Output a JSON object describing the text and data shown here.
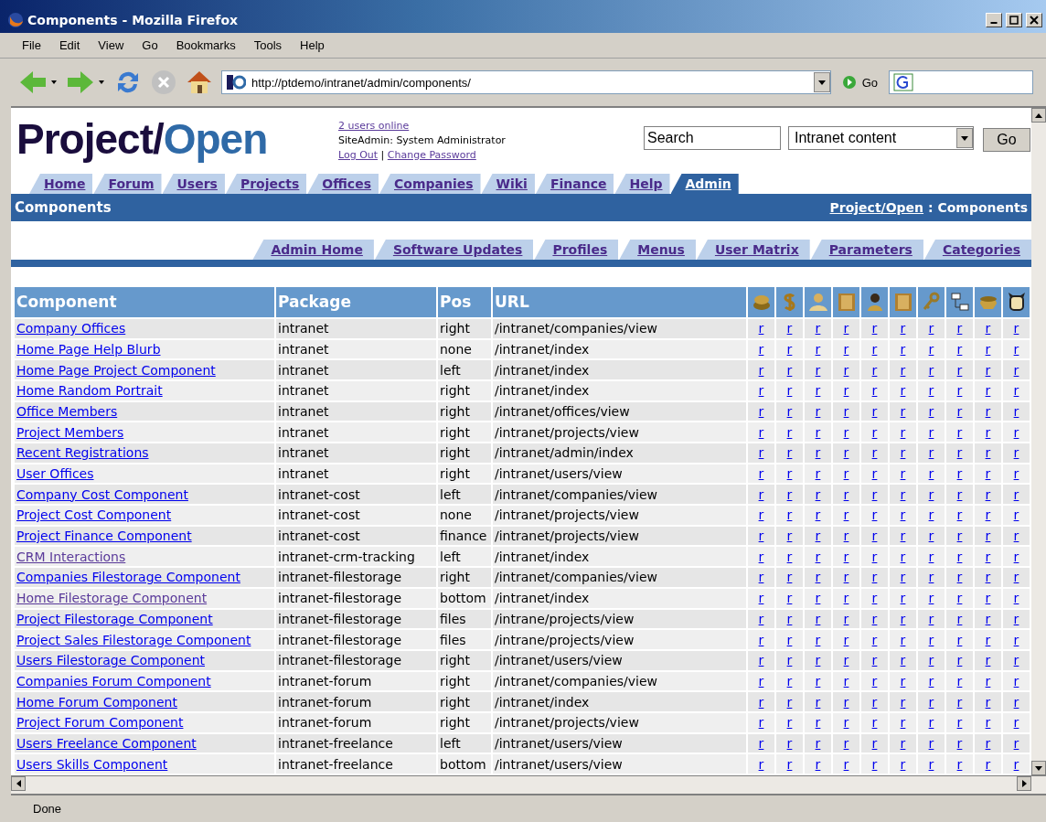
{
  "window": {
    "title": "Components - Mozilla Firefox"
  },
  "menu": [
    "File",
    "Edit",
    "View",
    "Go",
    "Bookmarks",
    "Tools",
    "Help"
  ],
  "toolbar": {
    "url": "http://ptdemo/intranet/admin/components/",
    "go": "Go"
  },
  "header": {
    "logo_dark": "Project/",
    "logo_light": "Open",
    "users_online": "2 users online",
    "user": "SiteAdmin: System Administrator",
    "logout": "Log Out",
    "separator": "|",
    "change_password": "Change Password",
    "search": {
      "value": "Search"
    },
    "scope": "Intranet content",
    "go": "Go"
  },
  "tabs": [
    {
      "label": "Home",
      "selected": false
    },
    {
      "label": "Forum",
      "selected": false
    },
    {
      "label": "Users",
      "selected": false
    },
    {
      "label": "Projects",
      "selected": false
    },
    {
      "label": "Offices",
      "selected": false
    },
    {
      "label": "Companies",
      "selected": false
    },
    {
      "label": "Wiki",
      "selected": false
    },
    {
      "label": "Finance",
      "selected": false
    },
    {
      "label": "Help",
      "selected": false
    },
    {
      "label": "Admin",
      "selected": true
    }
  ],
  "section": {
    "title": "Components",
    "breadcrumb_link": "Project/Open",
    "breadcrumb_rest": " : Components"
  },
  "subtabs": [
    "Admin Home",
    "Software Updates",
    "Profiles",
    "Menus",
    "User Matrix",
    "Parameters",
    "Categories"
  ],
  "table": {
    "columns": [
      "Component",
      "Package",
      "Pos",
      "URL"
    ],
    "rows": [
      {
        "component": "Company Offices",
        "visited": false,
        "package": "intranet",
        "pos": "right",
        "url": "/intranet/companies/view",
        "perms": [
          "r",
          "r",
          "r",
          "r",
          "r",
          "r",
          "r",
          "r",
          "r",
          "r"
        ]
      },
      {
        "component": "Home Page Help Blurb",
        "visited": false,
        "package": "intranet",
        "pos": "none",
        "url": "/intranet/index",
        "perms": [
          "r",
          "r",
          "r",
          "r",
          "r",
          "r",
          "r",
          "r",
          "r",
          "r"
        ]
      },
      {
        "component": "Home Page Project Component",
        "visited": false,
        "package": "intranet",
        "pos": "left",
        "url": "/intranet/index",
        "perms": [
          "r",
          "r",
          "r",
          "r",
          "r",
          "r",
          "r",
          "r",
          "r",
          "r"
        ]
      },
      {
        "component": "Home Random Portrait",
        "visited": false,
        "package": "intranet",
        "pos": "right",
        "url": "/intranet/index",
        "perms": [
          "r",
          "r",
          "r",
          "r",
          "r",
          "r",
          "r",
          "r",
          "r",
          "r"
        ]
      },
      {
        "component": "Office Members",
        "visited": false,
        "package": "intranet",
        "pos": "right",
        "url": "/intranet/offices/view",
        "perms": [
          "r",
          "r",
          "r",
          "r",
          "r",
          "r",
          "r",
          "r",
          "r",
          "r"
        ]
      },
      {
        "component": "Project Members",
        "visited": false,
        "package": "intranet",
        "pos": "right",
        "url": "/intranet/projects/view",
        "perms": [
          "r",
          "r",
          "r",
          "r",
          "r",
          "r",
          "r",
          "r",
          "r",
          "r"
        ]
      },
      {
        "component": "Recent Registrations",
        "visited": false,
        "package": "intranet",
        "pos": "right",
        "url": "/intranet/admin/index",
        "perms": [
          "r",
          "r",
          "r",
          "r",
          "r",
          "r",
          "r",
          "r",
          "r",
          "r"
        ]
      },
      {
        "component": "User Offices",
        "visited": false,
        "package": "intranet",
        "pos": "right",
        "url": "/intranet/users/view",
        "perms": [
          "r",
          "r",
          "r",
          "r",
          "r",
          "r",
          "r",
          "r",
          "r",
          "r"
        ]
      },
      {
        "component": "Company Cost Component",
        "visited": false,
        "package": "intranet-cost",
        "pos": "left",
        "url": "/intranet/companies/view",
        "perms": [
          "r",
          "r",
          "r",
          "r",
          "r",
          "r",
          "r",
          "r",
          "r",
          "r"
        ]
      },
      {
        "component": "Project Cost Component",
        "visited": false,
        "package": "intranet-cost",
        "pos": "none",
        "url": "/intranet/projects/view",
        "perms": [
          "r",
          "r",
          "r",
          "r",
          "r",
          "r",
          "r",
          "r",
          "r",
          "r"
        ]
      },
      {
        "component": "Project Finance Component",
        "visited": false,
        "package": "intranet-cost",
        "pos": "finance",
        "url": "/intranet/projects/view",
        "perms": [
          "r",
          "r",
          "r",
          "r",
          "r",
          "r",
          "r",
          "r",
          "r",
          "r"
        ]
      },
      {
        "component": "CRM Interactions",
        "visited": true,
        "package": "intranet-crm-tracking",
        "pos": "left",
        "url": "/intranet/index",
        "perms": [
          "r",
          "r",
          "r",
          "r",
          "r",
          "r",
          "r",
          "r",
          "r",
          "r"
        ]
      },
      {
        "component": "Companies Filestorage Component",
        "visited": false,
        "package": "intranet-filestorage",
        "pos": "right",
        "url": "/intranet/companies/view",
        "perms": [
          "r",
          "r",
          "r",
          "r",
          "r",
          "r",
          "r",
          "r",
          "r",
          "r"
        ]
      },
      {
        "component": "Home Filestorage Component",
        "visited": true,
        "package": "intranet-filestorage",
        "pos": "bottom",
        "url": "/intranet/index",
        "perms": [
          "r",
          "r",
          "r",
          "r",
          "r",
          "r",
          "r",
          "r",
          "r",
          "r"
        ]
      },
      {
        "component": "Project Filestorage Component",
        "visited": false,
        "package": "intranet-filestorage",
        "pos": "files",
        "url": "/intrane/projects/view",
        "perms": [
          "r",
          "r",
          "r",
          "r",
          "r",
          "r",
          "r",
          "r",
          "r",
          "r"
        ]
      },
      {
        "component": "Project Sales Filestorage Component",
        "visited": false,
        "package": "intranet-filestorage",
        "pos": "files",
        "url": "/intrane/projects/view",
        "perms": [
          "r",
          "r",
          "r",
          "r",
          "r",
          "r",
          "r",
          "r",
          "r",
          "r"
        ]
      },
      {
        "component": "Users Filestorage Component",
        "visited": false,
        "package": "intranet-filestorage",
        "pos": "right",
        "url": "/intranet/users/view",
        "perms": [
          "r",
          "r",
          "r",
          "r",
          "r",
          "r",
          "r",
          "r",
          "r",
          "r"
        ]
      },
      {
        "component": "Companies Forum Component",
        "visited": false,
        "package": "intranet-forum",
        "pos": "right",
        "url": "/intranet/companies/view",
        "perms": [
          "r",
          "r",
          "r",
          "r",
          "r",
          "r",
          "r",
          "r",
          "r",
          "r"
        ]
      },
      {
        "component": "Home Forum Component",
        "visited": false,
        "package": "intranet-forum",
        "pos": "right",
        "url": "/intranet/index",
        "perms": [
          "r",
          "r",
          "r",
          "r",
          "r",
          "r",
          "r",
          "r",
          "r",
          "r"
        ]
      },
      {
        "component": "Project Forum Component",
        "visited": false,
        "package": "intranet-forum",
        "pos": "right",
        "url": "/intranet/projects/view",
        "perms": [
          "r",
          "r",
          "r",
          "r",
          "r",
          "r",
          "r",
          "r",
          "r",
          "r"
        ]
      },
      {
        "component": "Users Freelance Component",
        "visited": false,
        "package": "intranet-freelance",
        "pos": "left",
        "url": "/intranet/users/view",
        "perms": [
          "r",
          "r",
          "r",
          "r",
          "r",
          "r",
          "r",
          "r",
          "r",
          "r"
        ]
      },
      {
        "component": "Users Skills Component",
        "visited": false,
        "package": "intranet-freelance",
        "pos": "bottom",
        "url": "/intranet/users/view",
        "perms": [
          "r",
          "r",
          "r",
          "r",
          "r",
          "r",
          "r",
          "r",
          "r",
          "r"
        ]
      }
    ]
  },
  "status_bar": "Done"
}
